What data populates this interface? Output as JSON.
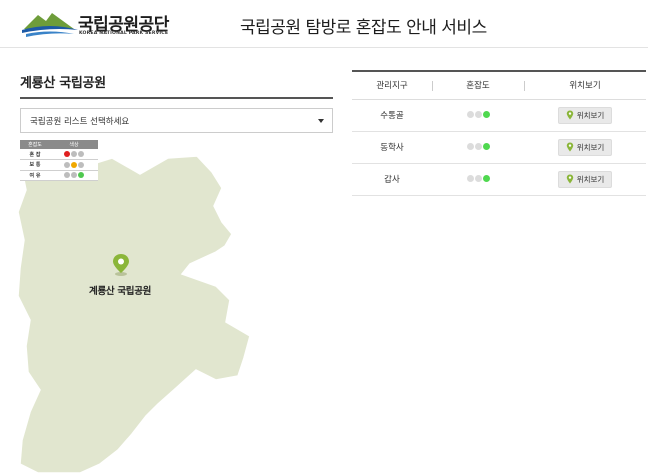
{
  "header": {
    "logo_name": "국립공원공단",
    "logo_sub": "KOREA NATIONAL PARK SERVICE",
    "service_title": "국립공원 탐방로 혼잡도 안내 서비스"
  },
  "left": {
    "park_heading": "계룡산 국립공원",
    "select_value": "국립공원 리스트 선택하세요",
    "legend": {
      "headers": [
        "혼잡도",
        "색상"
      ],
      "rows": [
        {
          "label": "혼 잡",
          "colors": [
            "#e02020",
            "#bdbdbd",
            "#bdbdbd"
          ]
        },
        {
          "label": "보 통",
          "colors": [
            "#bdbdbd",
            "#f0a800",
            "#bdbdbd"
          ]
        },
        {
          "label": "여 유",
          "colors": [
            "#bdbdbd",
            "#bdbdbd",
            "#4fc84f"
          ]
        }
      ]
    },
    "map_label": "계룡산 국립공원",
    "map_fill": "#e1e6cf",
    "pin_color": "#8bb63a"
  },
  "table": {
    "headers": [
      "관리지구",
      "혼잡도",
      "위치보기"
    ],
    "rows": [
      {
        "district": "수통골",
        "level": "여유",
        "button": "위치보기"
      },
      {
        "district": "동학사",
        "level": "여유",
        "button": "위치보기"
      },
      {
        "district": "갑사",
        "level": "여유",
        "button": "위치보기"
      }
    ],
    "dot_colors": [
      "#dcdcdc",
      "#dcdcdc",
      "#4fd84f"
    ]
  }
}
